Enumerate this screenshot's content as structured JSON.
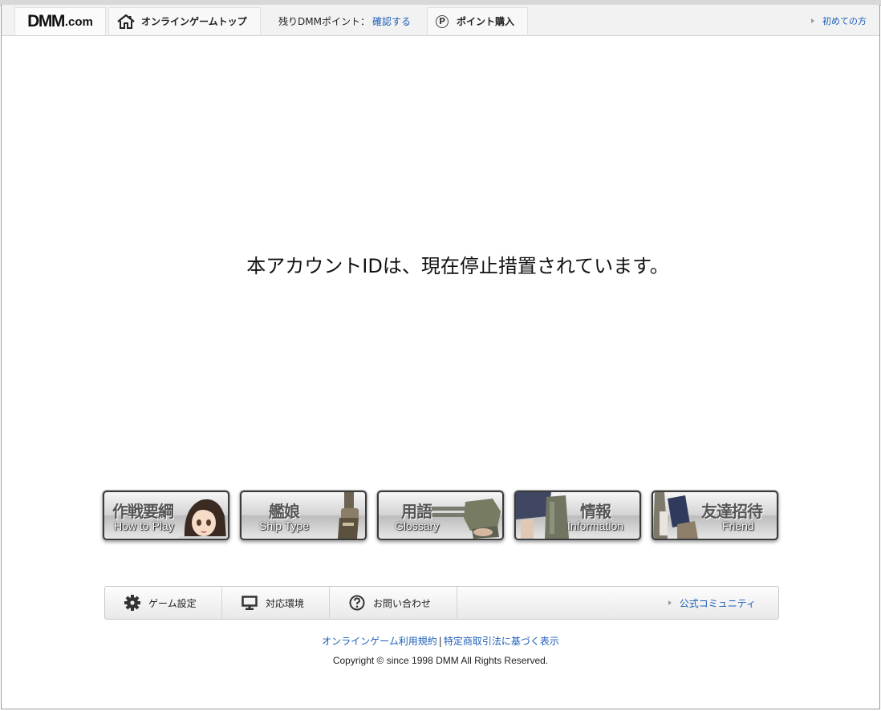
{
  "header": {
    "logo_main": "DMM",
    "logo_suffix": ".com",
    "game_top": "オンラインゲームトップ",
    "points_label": "残りDMMポイント：",
    "points_link": "確認する",
    "buy_icon": "P",
    "buy_points": "ポイント購入",
    "first_time": "初めての方"
  },
  "message": "本アカウントIDは、現在停止措置されています。",
  "game_buttons": [
    {
      "kanji": "作戦要綱",
      "english": "How to Play"
    },
    {
      "kanji": "艦娘",
      "english": "Ship Type"
    },
    {
      "kanji": "用語",
      "english": "Glossary"
    },
    {
      "kanji": "情報",
      "english": "Information"
    },
    {
      "kanji": "友達招待",
      "english": "Friend"
    }
  ],
  "footer_menu": {
    "settings": "ゲーム設定",
    "environment": "対応環境",
    "contact": "お問い合わせ",
    "community": "公式コミュニティ"
  },
  "links": {
    "terms": "オンラインゲーム利用規約",
    "separator": "|",
    "commerce": "特定商取引法に基づく表示"
  },
  "copyright": "Copyright © since 1998 DMM All Rights Reserved.",
  "colors": {
    "link": "#1d5fb8",
    "header_bg": "#f2f2f2"
  }
}
